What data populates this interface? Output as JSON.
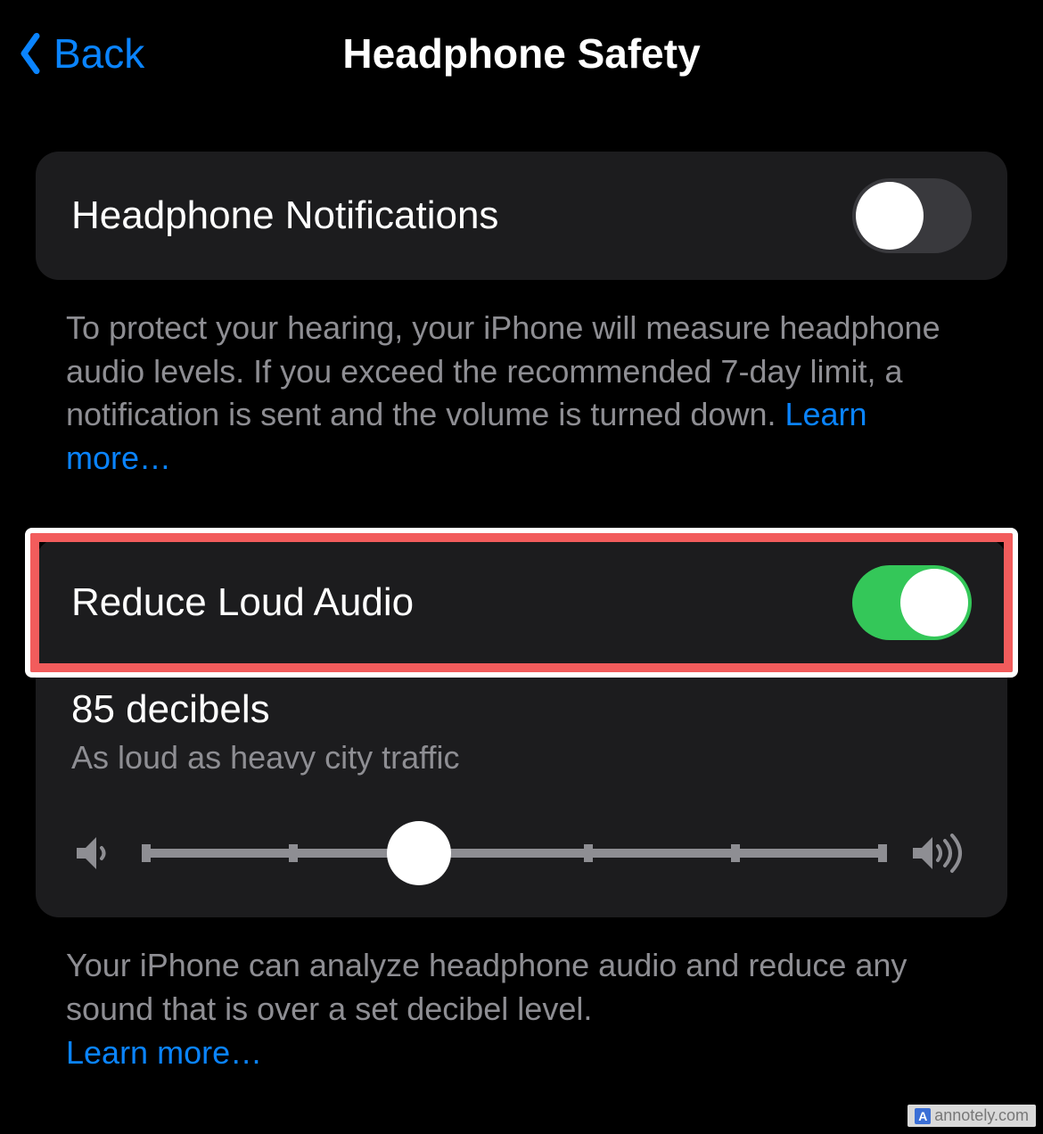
{
  "header": {
    "back_label": "Back",
    "title": "Headphone Safety"
  },
  "section1": {
    "row_label": "Headphone Notifications",
    "toggle_on": false,
    "footer_text": "To protect your hearing, your iPhone will measure headphone audio levels. If you exceed the recommended 7-day limit, a notification is sent and the volume is turned down. ",
    "learn_more": "Learn more…"
  },
  "section2": {
    "row_label": "Reduce Loud Audio",
    "toggle_on": true,
    "db_value_label": "85 decibels",
    "db_comparison": "As loud as heavy city traffic",
    "slider_percent": 37,
    "footer_text": "Your iPhone can analyze headphone audio and reduce any sound that is over a set decibel level. ",
    "learn_more": "Learn more…"
  },
  "watermark": "annotely.com",
  "colors": {
    "accent": "#0a84ff",
    "toggle_on": "#34c759",
    "highlight": "#f25c5c"
  }
}
